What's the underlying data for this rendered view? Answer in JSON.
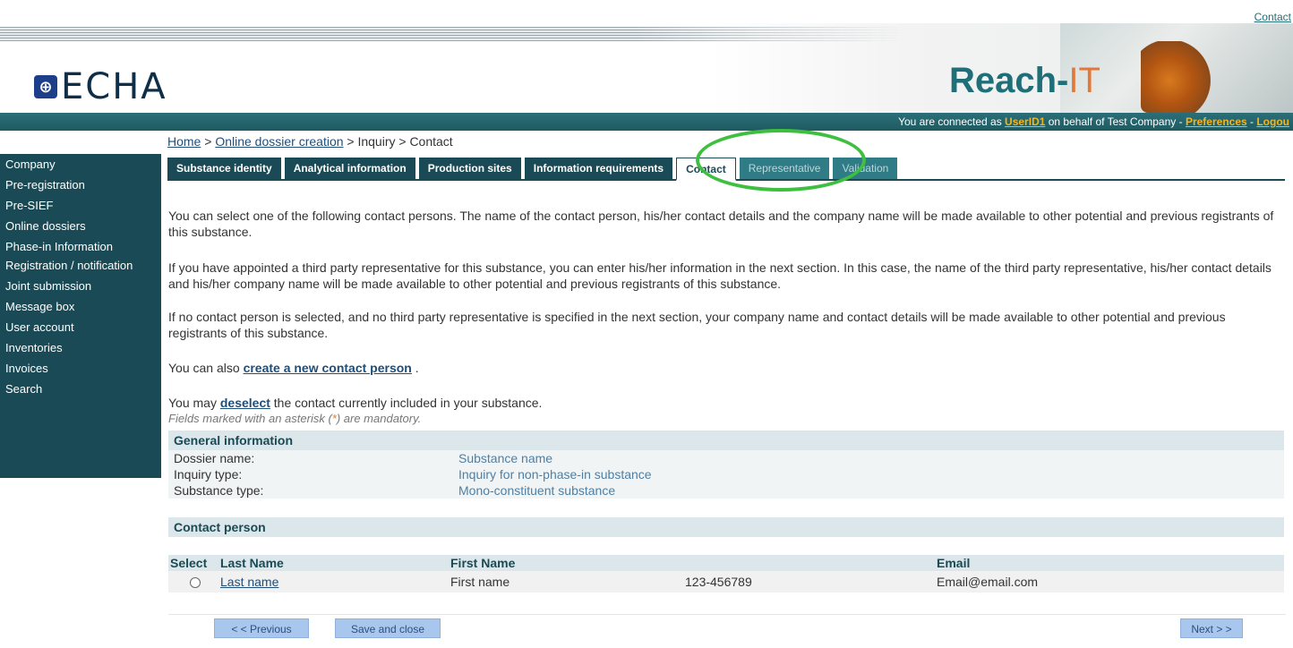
{
  "top_link": "Contact",
  "brand": {
    "logo_text": "ECHA",
    "reach_prefix": "Reach-",
    "reach_suffix": "IT"
  },
  "status_bar": {
    "prefix": "You are connected as ",
    "user": "UserID1",
    "middle": " on behalf of Test Company - ",
    "preferences": "Preferences",
    "sep": " - ",
    "logout": "Logou"
  },
  "breadcrumb": {
    "home": "Home",
    "sep1": " > ",
    "online": "Online dossier creation",
    "rest": " > Inquiry > Contact"
  },
  "sidebar": {
    "items": [
      {
        "label": "Company"
      },
      {
        "label": "Pre-registration"
      },
      {
        "label": "Pre-SIEF"
      },
      {
        "label": "Online dossiers"
      },
      {
        "label": "Phase-in Information"
      },
      {
        "label": "Registration / notification"
      },
      {
        "label": "Joint submission"
      },
      {
        "label": "Message box"
      },
      {
        "label": "User account"
      },
      {
        "label": "Inventories"
      },
      {
        "label": "Invoices"
      },
      {
        "label": "Search"
      }
    ]
  },
  "tabs": [
    {
      "label": "Substance identity"
    },
    {
      "label": "Analytical information"
    },
    {
      "label": "Production sites"
    },
    {
      "label": "Information requirements"
    },
    {
      "label": "Contact"
    },
    {
      "label": "Representative"
    },
    {
      "label": "Validation"
    }
  ],
  "content": {
    "p1": "You can select one of the following contact persons. The name of the contact person, his/her contact details and the company name will be made available to other potential and previous registrants of this substance.",
    "p2": "If you have appointed a third party representative for this substance, you can enter his/her information in the next section. In this case, the name of the third party representative, his/her contact details and his/her company name will be made available to other potential and previous registrants of this substance.",
    "p3": "If no contact person is selected, and no third party representative is specified in the next section, your company name and contact details will be made available to other potential and previous registrants of this substance.",
    "p4_prefix": "You can also ",
    "p4_link": "create a new contact person",
    "p4_suffix": " .",
    "p5_prefix": "You may ",
    "p5_link": "deselect",
    "p5_suffix": " the contact currently included in your substance.",
    "p6_prefix": "Fields marked with an asterisk (",
    "p6_ast": "*",
    "p6_suffix": ") are mandatory."
  },
  "general": {
    "title": "General information",
    "rows": [
      {
        "key": "Dossier name:",
        "value": "Substance name"
      },
      {
        "key": "Inquiry type:",
        "value": "Inquiry for non-phase-in substance"
      },
      {
        "key": "Substance type:",
        "value": "Mono-constituent substance"
      }
    ]
  },
  "contact_section": {
    "title": "Contact person",
    "headers": [
      "Select",
      "Last Name",
      "First Name",
      "",
      "Email"
    ],
    "row": {
      "last_name": "Last name",
      "first_name": "First name",
      "phone": "123-456789",
      "email": "Email@email.com"
    }
  },
  "footer": {
    "previous": "< < Previous",
    "save": "Save and close",
    "next": "Next > >"
  },
  "colors": {
    "sidebar_bg": "#1a4a55",
    "tab_bg": "#1a4a55",
    "highlight_ellipse": "#3fbf3f",
    "button_bg": "#a9c7ec"
  }
}
